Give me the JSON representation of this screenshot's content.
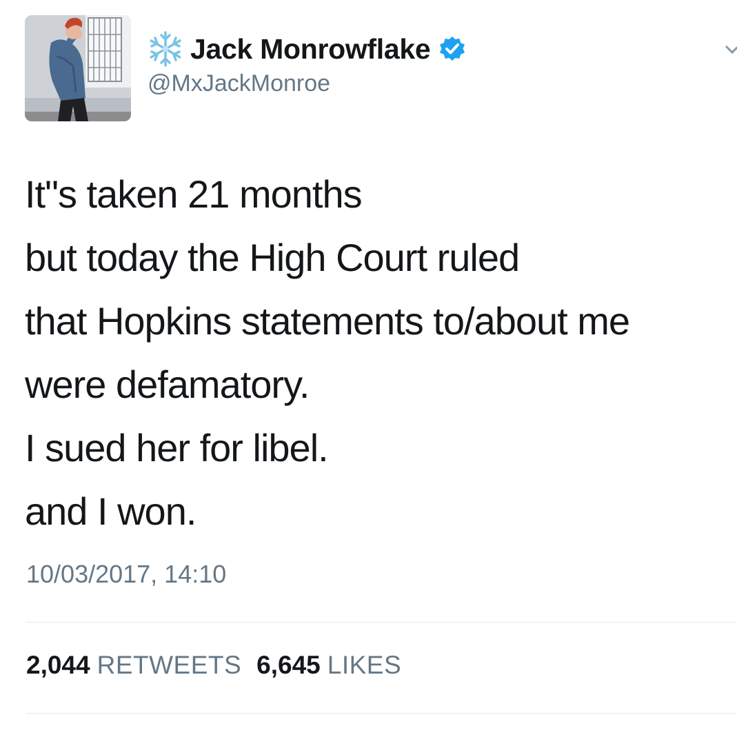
{
  "tweet": {
    "author": {
      "display_name": "Jack Monrowflake",
      "handle": "@MxJackMonroe",
      "emoji_icon": "snowflake-icon",
      "verified_icon": "verified-badge-icon",
      "avatar": "profile-avatar"
    },
    "text_lines": [
      "It\"s taken 21 months",
      "but today the High Court ruled",
      "that Hopkins statements to/about me",
      "were defamatory.",
      "I sued her for libel.",
      "and I won."
    ],
    "timestamp": "10/03/2017, 14:10",
    "stats": {
      "retweets_count": "2,044",
      "retweets_label": "RETWEETS",
      "likes_count": "6,645",
      "likes_label": "LIKES"
    },
    "menu_icon": "chevron-down-icon"
  },
  "colors": {
    "text_primary": "#14171a",
    "text_secondary": "#657786",
    "verified_blue": "#1da1f2",
    "divider": "#e1e8ed"
  }
}
